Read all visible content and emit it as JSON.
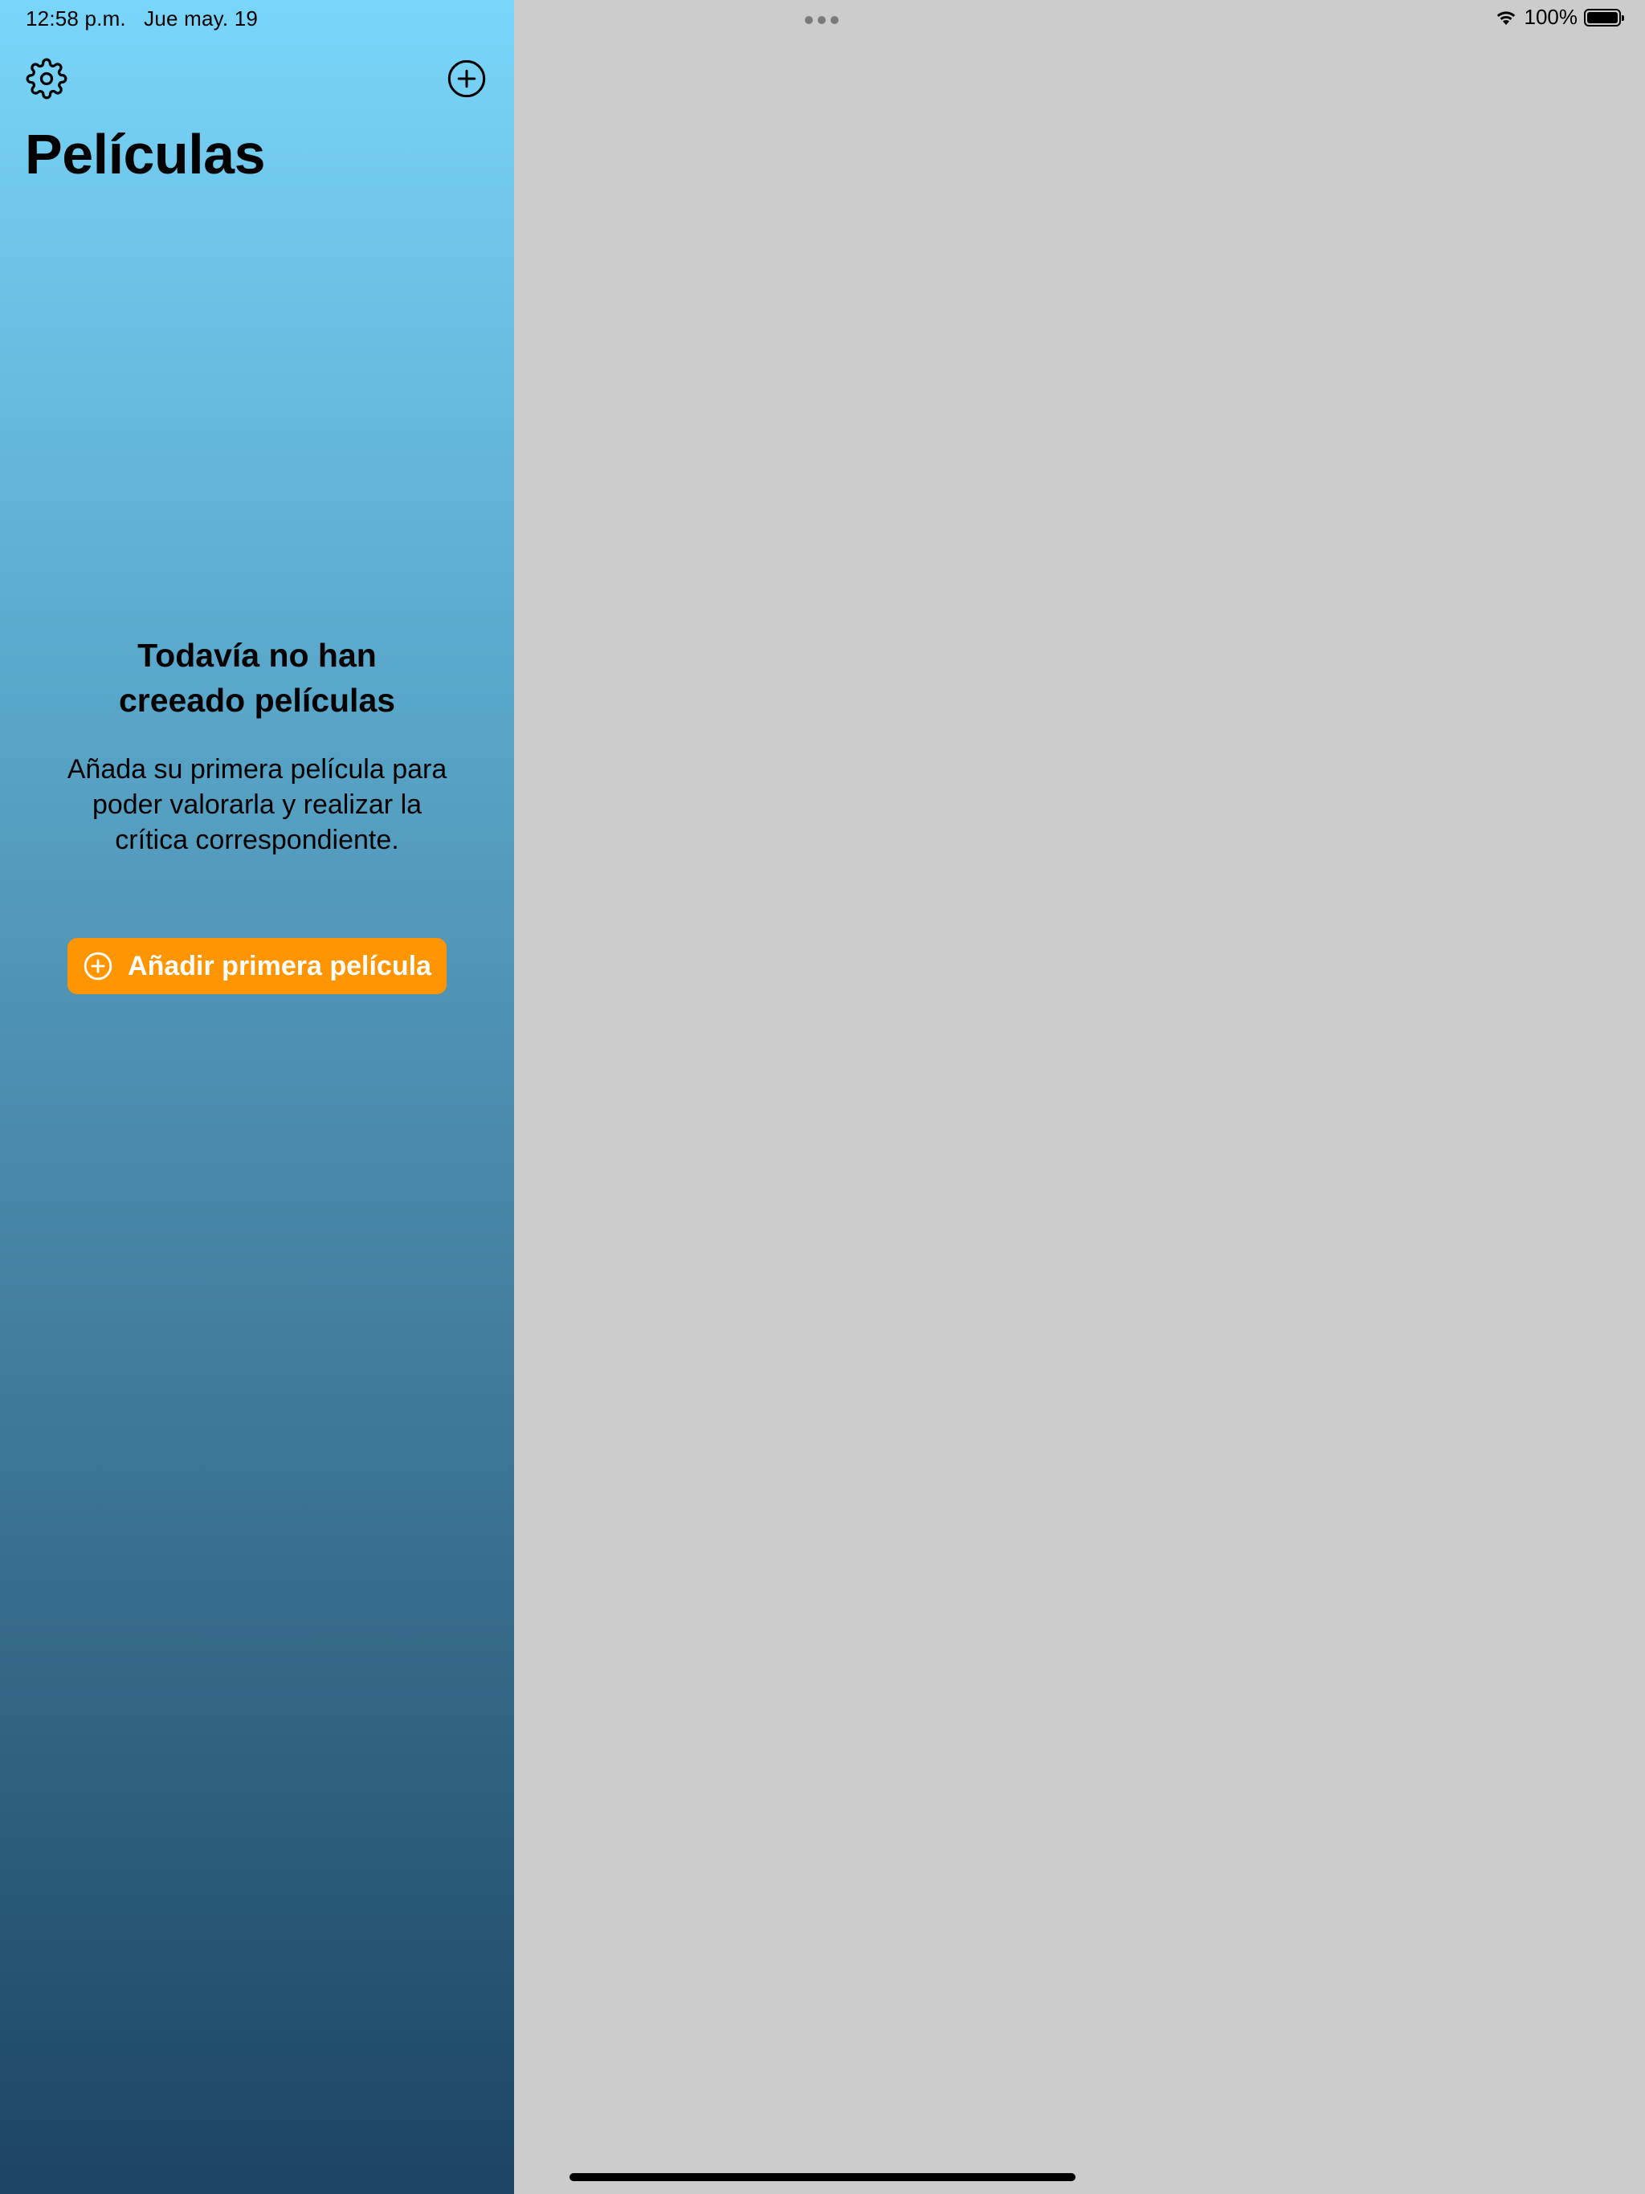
{
  "status_bar": {
    "time": "12:58 p.m.",
    "date": "Jue may. 19",
    "battery_percent": "100%",
    "battery_level": 1.0
  },
  "sidebar": {
    "title": "Películas",
    "settings_icon": "gear-icon",
    "add_icon": "plus-circle-icon"
  },
  "empty_state": {
    "title_line1": "Todavía no han",
    "title_line2": "creeado películas",
    "body_line1": "Añada su primera película para",
    "body_line2": "poder valorarla y realizar la",
    "body_line3": "crítica correspondiente.",
    "button_label": "Añadir primera película",
    "button_color": "#ff9500"
  },
  "colors": {
    "gradient_top": "#79d6fa",
    "gradient_bottom": "#1c4464",
    "detail_background": "#cccccc"
  }
}
